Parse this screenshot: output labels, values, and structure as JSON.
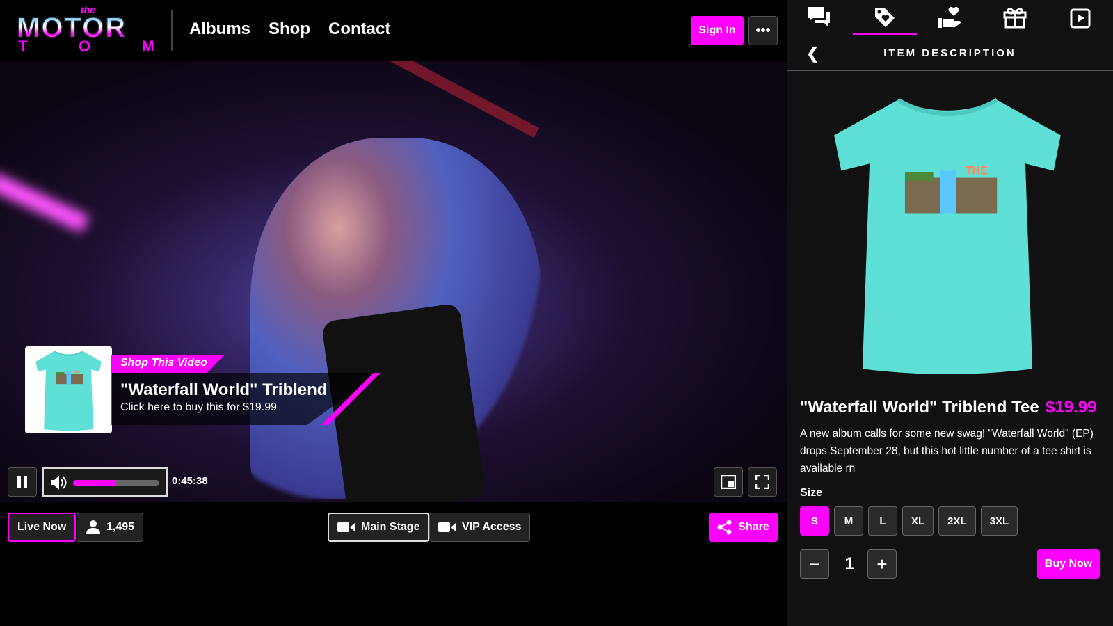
{
  "header": {
    "logo": {
      "the": "the",
      "motor": "MOTOR",
      "tom": [
        "T",
        "O",
        "M"
      ]
    },
    "nav": [
      "Albums",
      "Shop",
      "Contact"
    ],
    "sign_in": "Sign In",
    "more_icon": "more-horizontal-icon"
  },
  "video": {
    "shop_overlay": {
      "tag": "Shop This Video",
      "title": "\"Waterfall World\" Triblend",
      "subtitle": "Click here to buy this for $19.99"
    },
    "time": "0:45:38",
    "volume_percent": 50
  },
  "bottom_bar": {
    "live": "Live Now",
    "viewers": "1,495",
    "stages": [
      "Main Stage",
      "VIP Access"
    ],
    "share": "Share"
  },
  "panel": {
    "tabs": [
      {
        "icon": "chat-icon"
      },
      {
        "icon": "tag-heart-icon",
        "active": true
      },
      {
        "icon": "donate-heart-icon"
      },
      {
        "icon": "gift-icon"
      },
      {
        "icon": "video-play-icon"
      }
    ],
    "heading": "ITEM DESCRIPTION",
    "product": {
      "title": "\"Waterfall World\" Triblend Tee",
      "price": "$19.99",
      "description": "A new album calls for some new swag! \"Waterfall World\" (EP) drops September 28, but this hot little number of a tee shirt is available rn",
      "size_label": "Size",
      "sizes": [
        "S",
        "M",
        "L",
        "XL",
        "2XL",
        "3XL"
      ],
      "selected_size": "S",
      "quantity": "1",
      "buy": "Buy Now",
      "shirt_print": "THE MOTOR TOM"
    }
  },
  "colors": {
    "accent": "#ff00ff",
    "panel": "#111111",
    "tee": "#5fe0d6"
  }
}
